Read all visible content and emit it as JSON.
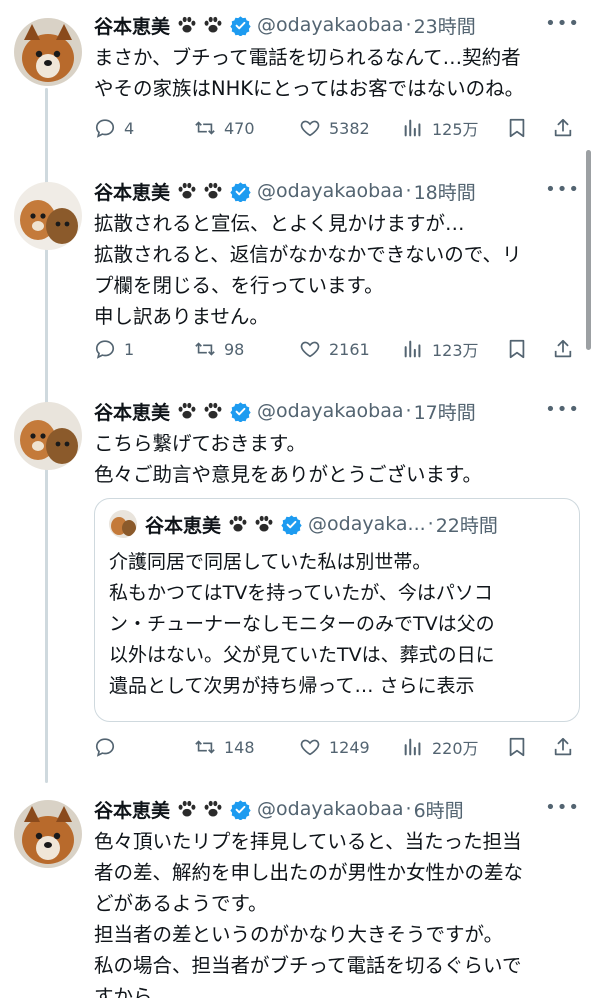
{
  "tweets": [
    {
      "name": "谷本恵美",
      "handle": "@odayakaobaa",
      "dot": "·",
      "time": "23時間",
      "text": "まさか、ブチって電話を切られるなんて…契約者\nやその家族はNHKにとってはお客ではないのね。",
      "reply_count": "4",
      "retweet_count": "470",
      "like_count": "5382",
      "view_count": "125万"
    },
    {
      "name": "谷本恵美",
      "handle": "@odayakaobaa",
      "dot": "·",
      "time": "18時間",
      "text": "拡散されると宣伝、とよく見かけますが…\n拡散されると、返信がなかなかできないので、リ\nプ欄を閉じる、を行っています。\n申し訳ありません。",
      "reply_count": "1",
      "retweet_count": "98",
      "like_count": "2161",
      "view_count": "123万"
    },
    {
      "name": "谷本恵美",
      "handle": "@odayakaobaa",
      "dot": "·",
      "time": "17時間",
      "text": "こちら繋げておきます。\n色々ご助言や意見をありがとうございます。",
      "reply_count": "",
      "retweet_count": "148",
      "like_count": "1249",
      "view_count": "220万",
      "quote": {
        "name": "谷本恵美",
        "handle": "@odayaka...",
        "dot": "·",
        "time": "22時間",
        "text": "介護同居で同居していた私は別世帯。\n私もかつてはTVを持っていたが、今はパソコ\nン・チューナーなしモニターのみでTVは父の\n以外はない。父が見ていたTVは、葬式の日に\n遺品として次男が持ち帰って… ",
        "show_more": "さらに表示"
      }
    },
    {
      "name": "谷本恵美",
      "handle": "@odayakaobaa",
      "dot": "·",
      "time": "6時間",
      "text": "色々頂いたリプを拝見していると、当たった担当\n者の差、解約を申し出たのが男性か女性かの差な\nどがあるようです。\n担当者の差というのがかなり大きそうですが。\n私の場合、担当者がブチって電話を切るぐらいで\nすから。"
    }
  ],
  "icons": {
    "more": "more-icon",
    "verified": "verified-badge-icon",
    "paw": "paw-icon"
  },
  "colors": {
    "text": "#0f1419",
    "secondary": "#536471",
    "verified": "#1d9bf0",
    "border": "#cfd9de"
  }
}
